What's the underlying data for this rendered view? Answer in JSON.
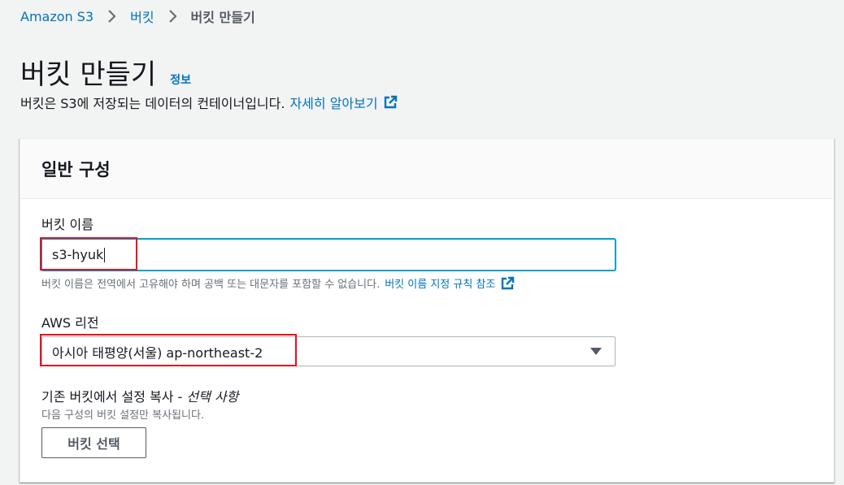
{
  "breadcrumb": {
    "items": [
      {
        "label": "Amazon S3"
      },
      {
        "label": "버킷"
      },
      {
        "label": "버킷 만들기"
      }
    ]
  },
  "header": {
    "title": "버킷 만들기",
    "info_link": "정보",
    "description": "버킷은 S3에 저장되는 데이터의 컨테이너입니다.",
    "learn_more": "자세히 알아보기"
  },
  "general_config": {
    "title": "일반 구성",
    "bucket_name": {
      "label": "버킷 이름",
      "value": "s3-hyuk",
      "hint": "버킷 이름은 전역에서 고유해야 하며 공백 또는 대문자를 포함할 수 없습니다.",
      "hint_link": "버킷 이름 지정 규칙 참조"
    },
    "region": {
      "label": "AWS 리전",
      "selected": "아시아 태평양(서울) ap-northeast-2"
    },
    "copy_settings": {
      "label": "기존 버킷에서 설정 복사 -",
      "optional": "선택 사항",
      "hint": "다음 구성의 버킷 설정만 복사됩니다.",
      "button": "버킷 선택"
    }
  },
  "colors": {
    "link": "#0073bb",
    "focus": "#00a1c9",
    "annotation": "#e8101f"
  },
  "icons": [
    "chevron-right-icon",
    "external-link-icon",
    "caret-down-icon"
  ]
}
